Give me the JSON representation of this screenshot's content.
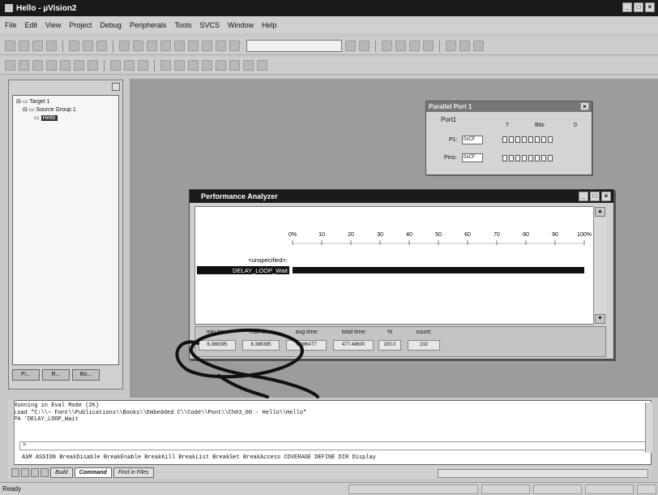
{
  "window": {
    "title": "Hello - µVision2",
    "min_label": "_",
    "max_label": "□",
    "close_label": "×"
  },
  "menu": [
    "File",
    "Edit",
    "View",
    "Project",
    "Debug",
    "Peripherals",
    "Tools",
    "SVCS",
    "Window",
    "Help"
  ],
  "project": {
    "tree": [
      {
        "label": "Target 1",
        "prefix": "⊟ ▭ "
      },
      {
        "label": "Source Group 1",
        "prefix": "⊟ ▭ "
      },
      {
        "label": "Hello",
        "prefix": "▭ "
      }
    ],
    "tabs": [
      "Fi...",
      "R...",
      "Bo..."
    ]
  },
  "parallel_port": {
    "title": "Parallel Port 1",
    "port_label": "Port1",
    "bits_label": "Bits",
    "bit_hi": "7",
    "bit_lo": "0",
    "p1_label": "P1:",
    "p1_value": "0xCF",
    "pins_label": "Pins:",
    "pins_value": "0xCF"
  },
  "perf": {
    "title": "Performance Analyzer",
    "scale": [
      "0%",
      "10",
      "20",
      "30",
      "40",
      "50",
      "60",
      "70",
      "80",
      "90",
      "100%"
    ],
    "rows": [
      {
        "label": "<unspecified>:",
        "percent": 0
      },
      {
        "label": "DELAY_LOOP_Wait",
        "percent": 100
      }
    ],
    "stats": {
      "min_time_label": "min time:",
      "min_time": "6.386395",
      "max_time_label": "max time:",
      "max_time": "6.386395",
      "avg_time_label": "avg time:",
      "avg_time": "6.386477",
      "total_time_label": "total time:",
      "total_time": "477.48600",
      "pct_label": "%",
      "pct": "100.0",
      "count_label": "count:",
      "count": "232"
    }
  },
  "command": {
    "lines": [
      "Running in Eval Mode (2K)",
      "Load \"C:\\\\~ Font\\\\Publications\\\\Books\\\\Embedded C\\\\Code\\\\Pont\\\\Ch03_00 - Hello\\\\Hello\"",
      "PA 'DELAY_LOOP_Wait"
    ],
    "prompt": ">",
    "keywords": "ASM ASSIGN BreakDisable BreakEnable BreakKill BreakList BreakSet BreakAccess COVERAGE DEFINE DIR Display",
    "tabs": [
      "Build",
      "Command",
      "Find in Files"
    ]
  },
  "status": {
    "text": "Ready"
  }
}
